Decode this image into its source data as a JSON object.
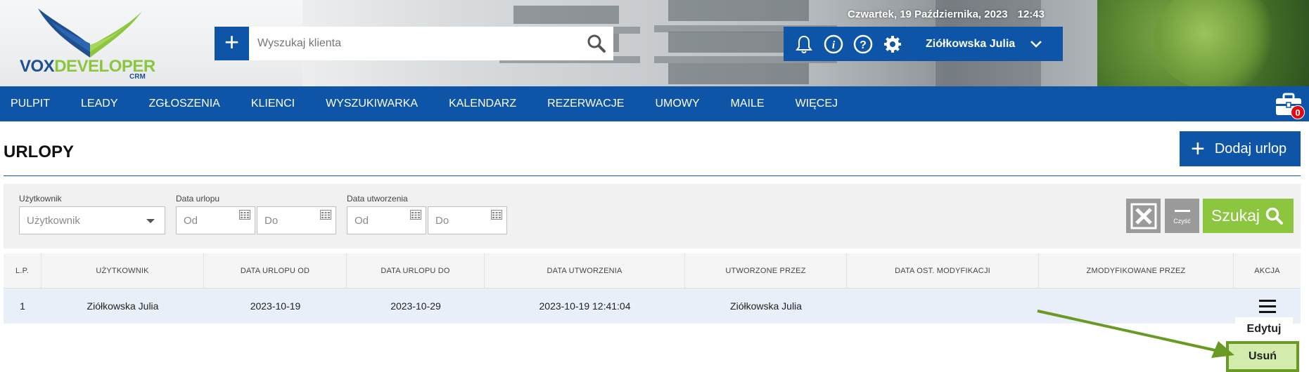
{
  "header": {
    "logo_text_vox": "VOX",
    "logo_text_developer": "DEVELOPER",
    "logo_sub": "CRM",
    "search_placeholder": "Wyszukaj klienta",
    "date_text": "Czwartek, 19 Października, 2023",
    "time_text": "12:43",
    "user_name": "Ziółkowska Julia"
  },
  "nav": {
    "items": [
      "PULPIT",
      "LEADY",
      "ZGŁOSZENIA",
      "KLIENCI",
      "WYSZUKIWARKA",
      "KALENDARZ",
      "REZERWACJE",
      "UMOWY",
      "MAILE",
      "WIĘCEJ"
    ],
    "toolbox_badge": "0"
  },
  "page": {
    "title": "URLOPY",
    "add_button": "Dodaj urlop"
  },
  "filters": {
    "user_label": "Użytkownik",
    "user_placeholder": "Użytkownik",
    "leave_date_label": "Data urlopu",
    "created_date_label": "Data utworzenia",
    "from_placeholder": "Od",
    "to_placeholder": "Do",
    "clear_label": "Czyść",
    "search_button": "Szukaj"
  },
  "table": {
    "headers": [
      "L.P.",
      "UŻYTKOWNIK",
      "DATA URLOPU OD",
      "DATA URLOPU DO",
      "DATA UTWORZENIA",
      "UTWORZONE PRZEZ",
      "DATA OST. MODYFIKACJI",
      "ZMODYFIKOWANE PRZEZ",
      "AKCJA"
    ],
    "rows": [
      [
        "1",
        "Ziółkowska Julia",
        "2023-10-19",
        "2023-10-29",
        "2023-10-19 12:41:04",
        "Ziółkowska Julia",
        "",
        ""
      ]
    ]
  },
  "action_menu": {
    "edit": "Edytuj",
    "delete": "Usuń"
  },
  "colors": {
    "primary": "#0e55a8",
    "accent_green": "#8cc63f",
    "highlight_arrow": "#6a9a23",
    "badge_red": "#e30613"
  }
}
